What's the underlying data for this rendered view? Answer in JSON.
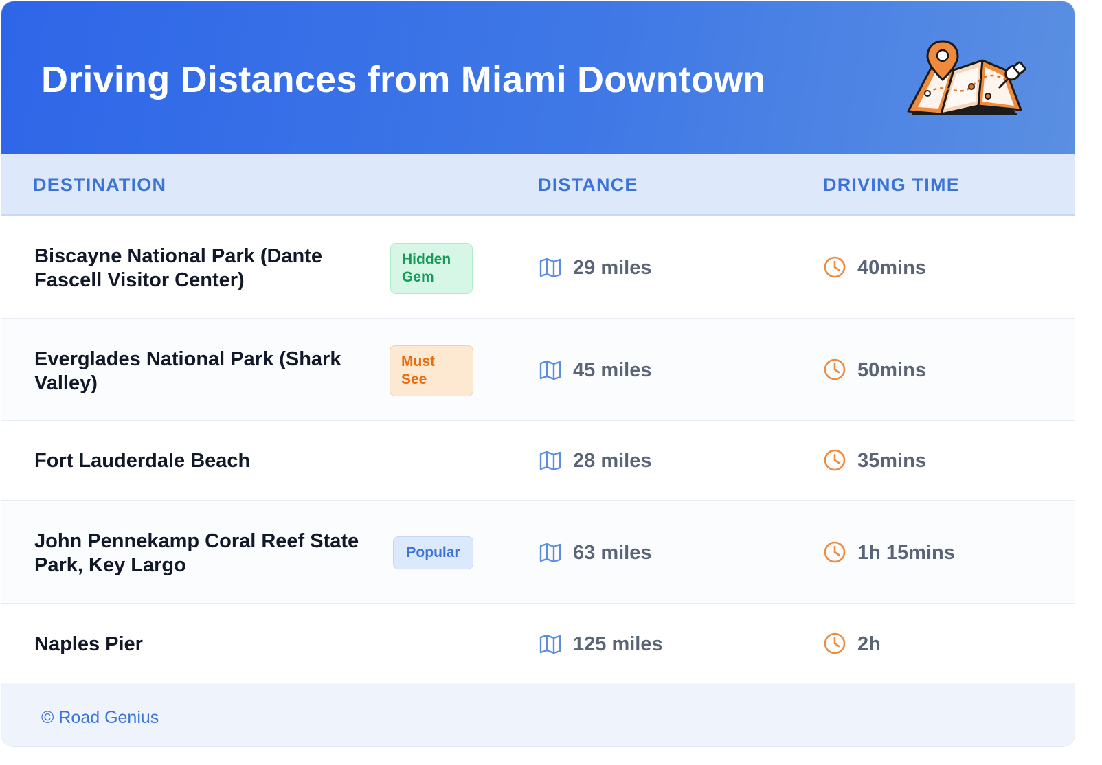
{
  "header": {
    "title": "Driving Distances from Miami Downtown",
    "illustration": "map-pin-icon",
    "colors": {
      "gradient_start": "#2e66e8",
      "gradient_end": "#5a8fe2"
    }
  },
  "columns": {
    "destination": "DESTINATION",
    "distance": "DISTANCE",
    "driving_time": "DRIVING TIME"
  },
  "rows": [
    {
      "destination": "Biscayne National Park (Dante Fascell Visitor Center)",
      "badge": "Hidden Gem",
      "badge_color": "#169a5a",
      "distance": "29 miles",
      "time": "40mins"
    },
    {
      "destination": "Everglades National Park (Shark Valley)",
      "badge": "Must See",
      "badge_color": "#ea6b0e",
      "distance": "45 miles",
      "time": "50mins"
    },
    {
      "destination": "Fort Lauderdale Beach",
      "badge": "",
      "distance": "28 miles",
      "time": "35mins"
    },
    {
      "destination": "John Pennekamp Coral Reef State Park, Key Largo",
      "badge": "Popular",
      "badge_color": "#3b74d6",
      "distance": "63 miles",
      "time": "1h 15mins"
    },
    {
      "destination": "Naples Pier",
      "badge": "",
      "distance": "125 miles",
      "time": "2h"
    }
  ],
  "icons": {
    "distance": "map-icon",
    "time": "clock-icon"
  },
  "footer": {
    "credit": "© Road Genius"
  }
}
